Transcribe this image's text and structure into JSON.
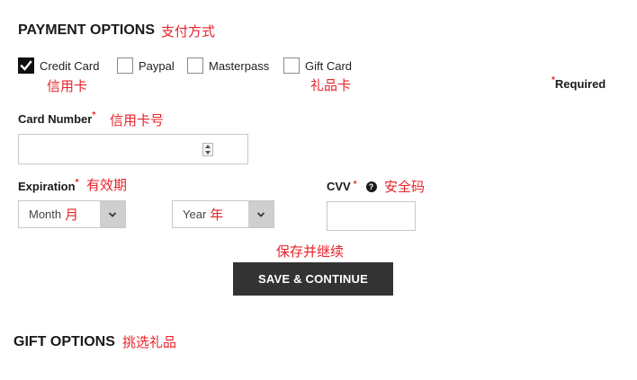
{
  "payment": {
    "heading": "PAYMENT OPTIONS",
    "heading_cn": "支付方式",
    "options": [
      {
        "label": "Credit Card",
        "checked": true,
        "cn": "信用卡"
      },
      {
        "label": "Paypal",
        "checked": false
      },
      {
        "label": "Masterpass",
        "checked": false
      },
      {
        "label": "Gift Card",
        "checked": false,
        "cn": "礼品卡"
      }
    ],
    "required_mark": "*",
    "required_label": "Required"
  },
  "card_number": {
    "label": "Card Number",
    "required_mark": "*",
    "cn": "信用卡号",
    "value": ""
  },
  "expiration": {
    "label": "Expiration",
    "required_mark": "*",
    "cn": "有效期",
    "month": {
      "selected": "Month",
      "cn": "月"
    },
    "year": {
      "selected": "Year",
      "cn": "年"
    }
  },
  "cvv": {
    "label": "CVV",
    "required_mark": "*",
    "help_glyph": "?",
    "cn": "安全码",
    "value": ""
  },
  "save": {
    "cn": "保存并继续",
    "label": "SAVE & CONTINUE"
  },
  "gift": {
    "heading": "GIFT OPTIONS",
    "heading_cn": "挑选礼品"
  },
  "colors": {
    "annotation_red": "#e8232a",
    "button_bg": "#333333",
    "select_arrow_bg": "#cfcfcf"
  }
}
